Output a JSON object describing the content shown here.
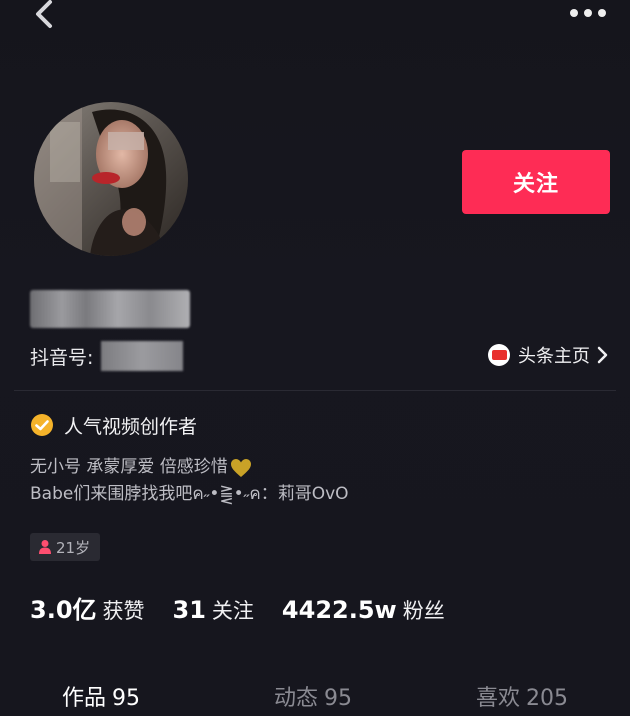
{
  "header": {
    "back_icon": "chevron-left-icon",
    "more_icon": "more-dots-icon"
  },
  "profile": {
    "follow_label": "关注",
    "douyin_id_label": "抖音号:",
    "toutiao_link_label": "头条主页",
    "toutiao_icon": "toutiao-logo-icon",
    "creator_badge_label": "人气视频创作者",
    "bio_line_1": "无小号 承蒙厚爱 倍感珍惜",
    "bio_line_2": "Babe们来围脖找我吧ค˶•⪌•˶ค：莉哥OvO",
    "age_tag": "21岁"
  },
  "stats": {
    "likes_value": "3.0亿",
    "likes_label": "获赞",
    "following_value": "31",
    "following_label": "关注",
    "fans_value": "4422.5w",
    "fans_label": "粉丝"
  },
  "tabs": [
    {
      "label": "作品",
      "count": "95"
    },
    {
      "label": "动态",
      "count": "95"
    },
    {
      "label": "喜欢",
      "count": "205"
    }
  ],
  "colors": {
    "background": "#16161d",
    "accent": "#fe2c55",
    "verified_badge": "#f5b32a",
    "heart": "#c9a227",
    "age_icon": "#ff4e70"
  }
}
